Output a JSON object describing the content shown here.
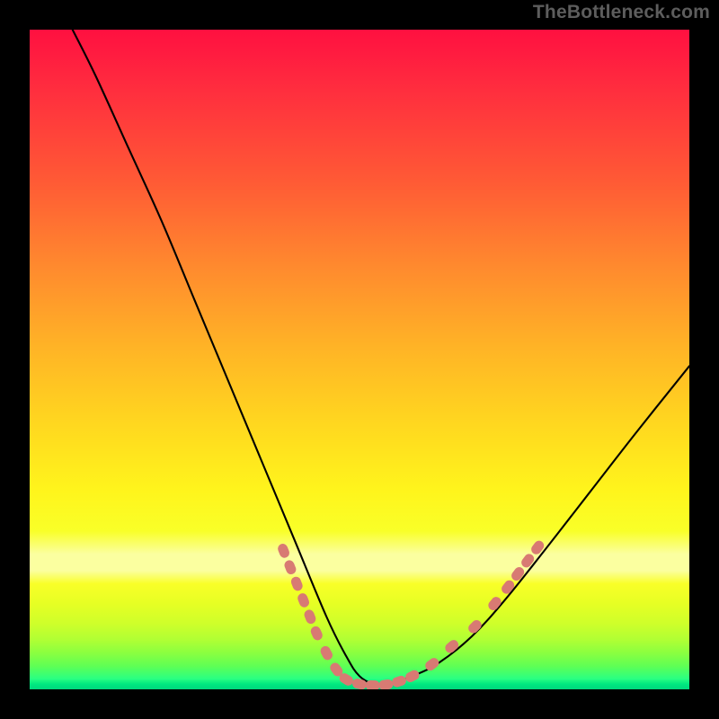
{
  "watermark": "TheBottleneck.com",
  "colors": {
    "background_black": "#000000",
    "watermark_gray": "#5d5d5d",
    "dot_fill": "#d87a73",
    "curve_stroke": "#000000"
  },
  "chart_data": {
    "type": "line",
    "title": "",
    "xlabel": "",
    "ylabel": "",
    "xlim": [
      0,
      100
    ],
    "ylim": [
      0,
      100
    ],
    "grid": false,
    "legend": false,
    "series": [
      {
        "name": "left-curve",
        "x": [
          6.5,
          10,
          15,
          20,
          25,
          30,
          35,
          40,
          45,
          48,
          50,
          52.5
        ],
        "y": [
          100,
          93,
          82,
          71,
          59,
          47,
          35,
          23,
          11,
          5,
          2,
          0.5
        ]
      },
      {
        "name": "right-curve",
        "x": [
          52.5,
          55,
          58,
          62,
          67,
          72,
          78,
          85,
          92,
          100
        ],
        "y": [
          0.5,
          1,
          2,
          4,
          8,
          13.5,
          21,
          30,
          39,
          49
        ]
      }
    ],
    "markers": {
      "name": "highlight-dots",
      "approx_points": [
        {
          "x": 38.5,
          "y": 21.0
        },
        {
          "x": 39.5,
          "y": 18.5
        },
        {
          "x": 40.5,
          "y": 16.0
        },
        {
          "x": 41.5,
          "y": 13.5
        },
        {
          "x": 42.5,
          "y": 11.0
        },
        {
          "x": 43.5,
          "y": 8.5
        },
        {
          "x": 45.0,
          "y": 5.5
        },
        {
          "x": 46.5,
          "y": 3.0
        },
        {
          "x": 48.0,
          "y": 1.5
        },
        {
          "x": 50.0,
          "y": 0.8
        },
        {
          "x": 52.0,
          "y": 0.6
        },
        {
          "x": 54.0,
          "y": 0.7
        },
        {
          "x": 56.0,
          "y": 1.2
        },
        {
          "x": 58.0,
          "y": 2.0
        },
        {
          "x": 61.0,
          "y": 3.8
        },
        {
          "x": 64.0,
          "y": 6.5
        },
        {
          "x": 67.5,
          "y": 9.5
        },
        {
          "x": 70.5,
          "y": 13.0
        },
        {
          "x": 72.5,
          "y": 15.5
        },
        {
          "x": 74.0,
          "y": 17.5
        },
        {
          "x": 75.5,
          "y": 19.5
        },
        {
          "x": 77.0,
          "y": 21.5
        }
      ]
    },
    "background_gradient": {
      "stops": [
        {
          "pos": 0.0,
          "color": "#ff1040"
        },
        {
          "pos": 0.23,
          "color": "#ff5a35"
        },
        {
          "pos": 0.48,
          "color": "#ffb326"
        },
        {
          "pos": 0.7,
          "color": "#fff51c"
        },
        {
          "pos": 0.8,
          "color": "#fbffa0"
        },
        {
          "pos": 0.9,
          "color": "#cfff2a"
        },
        {
          "pos": 0.97,
          "color": "#5eff55"
        },
        {
          "pos": 1.0,
          "color": "#00d87d"
        }
      ]
    }
  }
}
